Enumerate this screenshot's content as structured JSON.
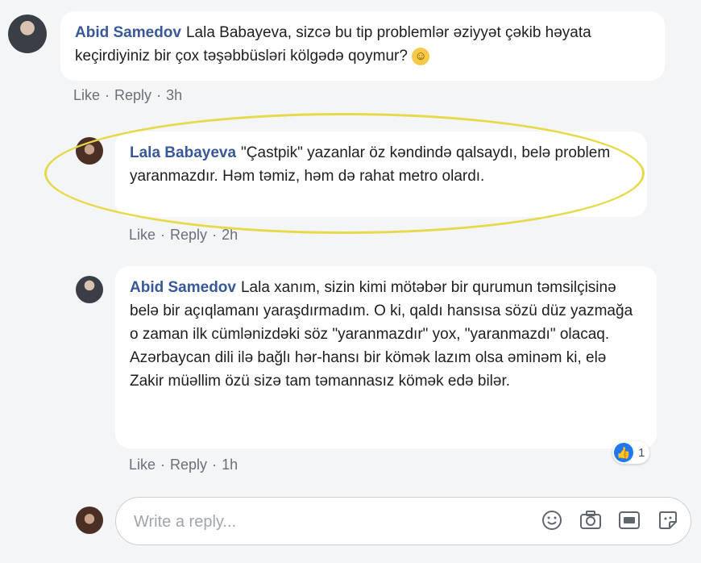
{
  "comments": [
    {
      "author": "Abid Samedov",
      "text": "Lala Babayeva, sizcə bu tip problemlər əziyyət çəkib həyata keçirdiyiniz bir çox təşəbbüsləri kölgədə qoymur?",
      "emoji": "☺",
      "like_label": "Like",
      "reply_label": "Reply",
      "time": "3h"
    },
    {
      "author": "Lala Babayeva",
      "text": "\"Çastpik\" yazanlar öz kəndində qalsaydı, belə problem yaranmazdır. Həm təmiz, həm də rahat metro olardı.",
      "like_label": "Like",
      "reply_label": "Reply",
      "time": "2h"
    },
    {
      "author": "Abid Samedov",
      "text": "Lala xanım, sizin kimi mötəbər bir qurumun təmsilçisinə belə bir açıqlamanı yaraşdırmadım. O ki, qaldı hansısa sözü düz yazmağa o zaman ilk cümlənizdəki söz \"yaranmazdır\" yox, \"yaranmazdı\" olacaq. Azərbaycan dili ilə bağlı hər-hansı bir kömək lazım olsa əminəm ki, elə Zakir müəllim özü sizə tam təmannasız kömək edə bilər.",
      "like_label": "Like",
      "reply_label": "Reply",
      "time": "1h",
      "reaction_count": "1"
    }
  ],
  "reply_box": {
    "placeholder": "Write a reply..."
  },
  "icons": [
    "emoji-icon",
    "camera-icon",
    "gif-icon",
    "sticker-icon"
  ],
  "colors": {
    "author": "#385898",
    "highlight": "#e6d94a",
    "like": "#2078f4"
  }
}
